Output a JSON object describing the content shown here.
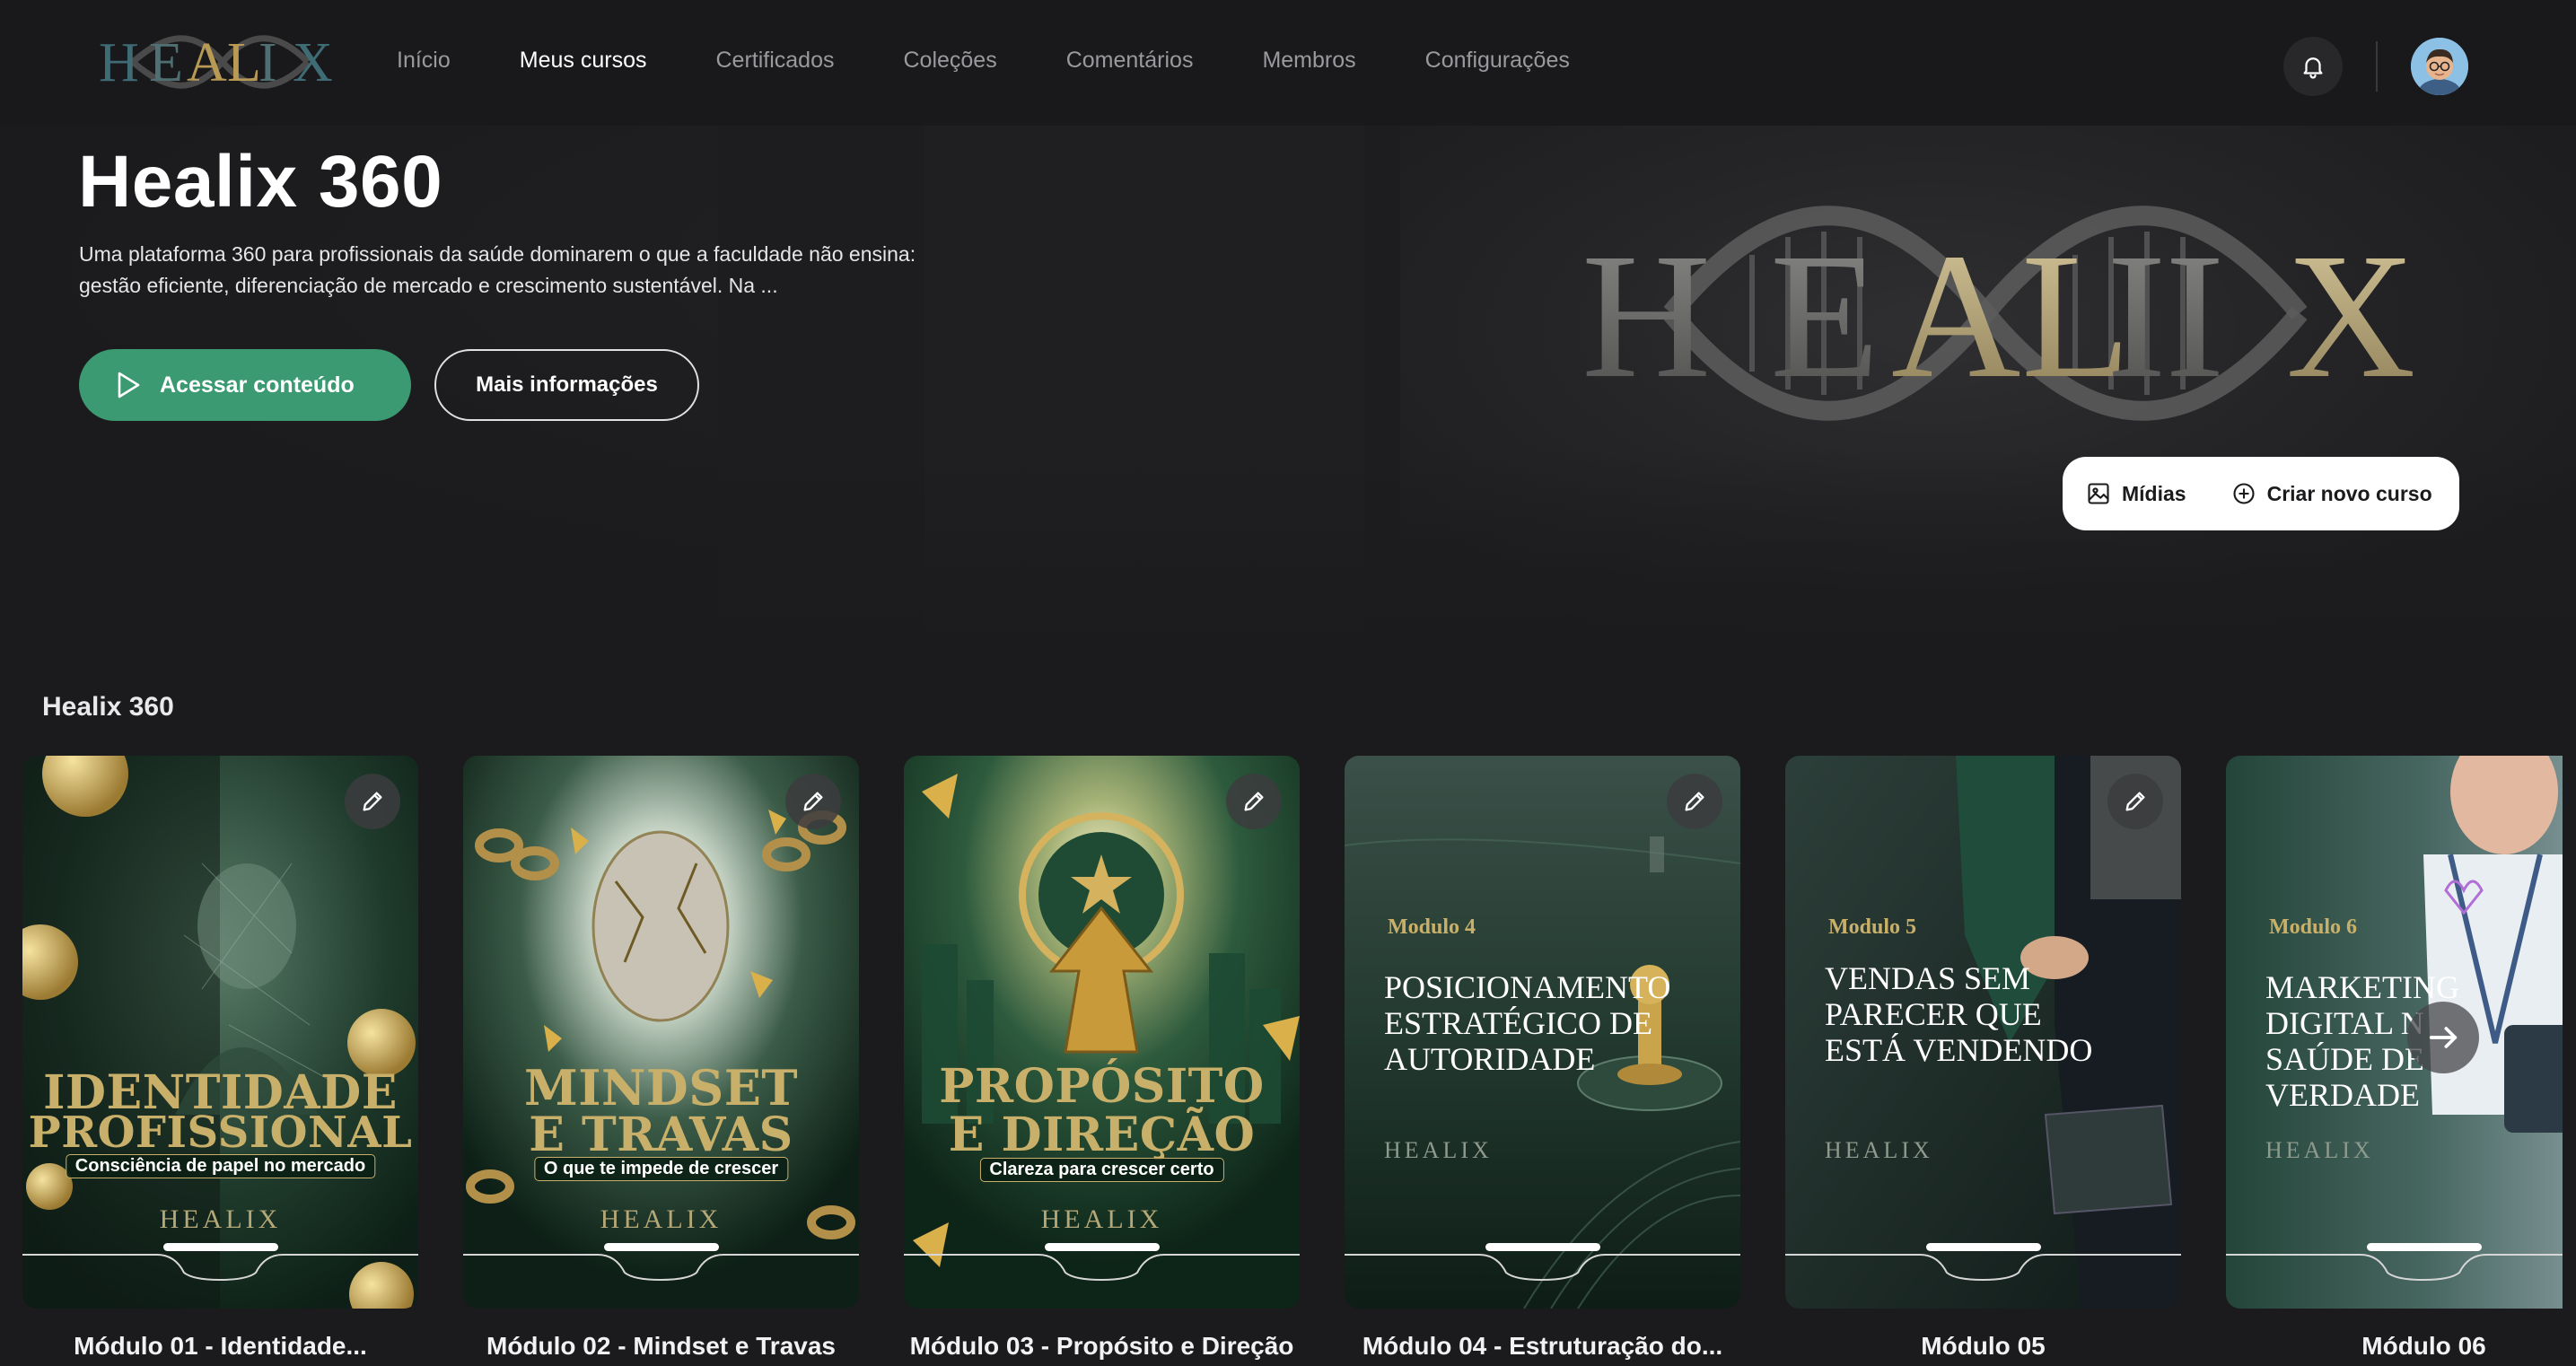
{
  "nav": {
    "logo_text": "HEALIX",
    "links": [
      {
        "label": "Início",
        "active": false
      },
      {
        "label": "Meus cursos",
        "active": true
      },
      {
        "label": "Certificados",
        "active": false
      },
      {
        "label": "Coleções",
        "active": false
      },
      {
        "label": "Comentários",
        "active": false
      },
      {
        "label": "Membros",
        "active": false
      },
      {
        "label": "Configurações",
        "active": false
      }
    ],
    "bell_icon": "bell-icon",
    "avatar_icon": "user-avatar"
  },
  "hero": {
    "title": "Healix 360",
    "description": " Uma plataforma 360 para profissionais da saúde dominarem o que a faculdade não ensina: gestão eficiente, diferenciação de mercado e crescimento sustentável. Na ...",
    "primary_button": "Acessar conteúdo",
    "secondary_button": "Mais informações",
    "logo_text": "HEALIX",
    "admin": {
      "media_label": "Mídias",
      "create_label": "Criar novo curso"
    }
  },
  "row": {
    "title": "Healix 360",
    "cards": [
      {
        "label": "Módulo 01 - Identidade...",
        "poster_title_1": "IDENTIDADE",
        "poster_title_2": "PROFISSIONAL",
        "poster_sub": "Consciência de papel no mercado",
        "brand": "HEALIX"
      },
      {
        "label": "Módulo 02 - Mindset e Travas",
        "poster_title_1": "MINDSET",
        "poster_title_2": "E TRAVAS",
        "poster_sub": "O que te impede de crescer",
        "brand": "HEALIX"
      },
      {
        "label": "Módulo 03 - Propósito e Direção",
        "poster_title_1": "PROPÓSITO",
        "poster_title_2": "E DIREÇÃO",
        "poster_sub": "Clareza para crescer certo",
        "brand": "HEALIX"
      },
      {
        "label": "Módulo 04 - Estruturação do...",
        "kicker": "Modulo 4",
        "poster_title": "Posicionamento estratégico de autoridade",
        "brand": "HEALIX"
      },
      {
        "label": "Módulo 05",
        "kicker": "Modulo 5",
        "poster_title": "Vendas sem parecer que está vendendo",
        "brand": "HEALIX"
      },
      {
        "label": "Módulo 06",
        "kicker": "Modulo 6",
        "poster_title": "Marketing digital n saúde de verdade",
        "brand": "HEALIX"
      }
    ]
  },
  "colors": {
    "background": "#1b1b1d",
    "accent": "#3b9a72",
    "gold": "#c9b06a"
  }
}
